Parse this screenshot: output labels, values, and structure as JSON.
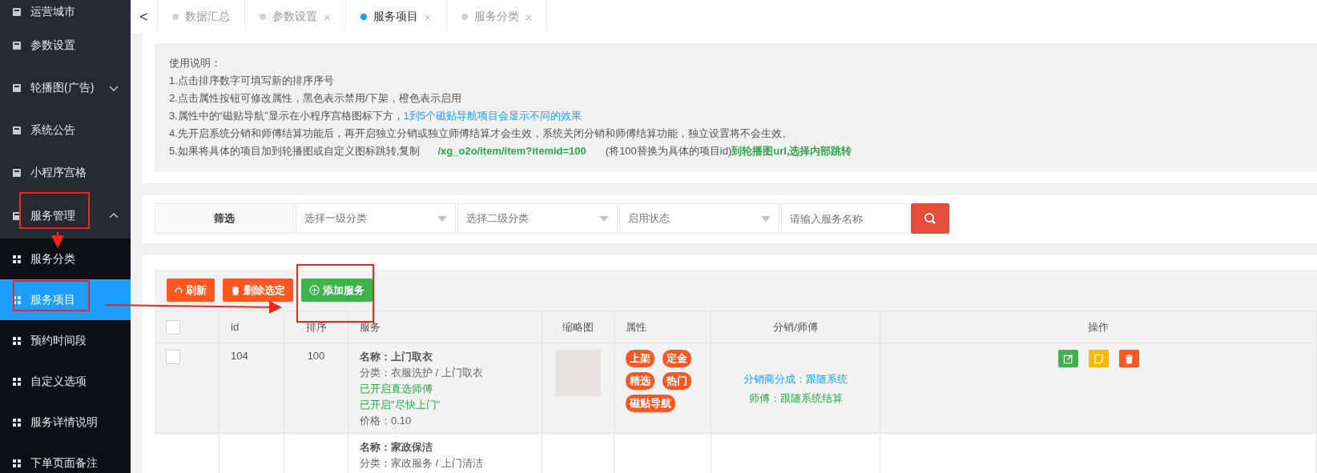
{
  "sidebar": {
    "items": [
      {
        "label": "运营城市"
      },
      {
        "label": "参数设置"
      },
      {
        "label": "轮播图(广告)",
        "expanded": false
      },
      {
        "label": "系统公告"
      },
      {
        "label": "小程序宫格"
      },
      {
        "label": "服务管理",
        "expanded": true,
        "children": [
          {
            "label": "服务分类",
            "selected": false
          },
          {
            "label": "服务项目",
            "selected": true
          },
          {
            "label": "预约时间段",
            "selected": false
          },
          {
            "label": "自定义选项",
            "selected": false
          },
          {
            "label": "服务详情说明",
            "selected": false
          },
          {
            "label": "下单页面备注",
            "selected": false
          }
        ]
      }
    ]
  },
  "tabs": [
    {
      "label": "数据汇总",
      "selected": false,
      "closable": false
    },
    {
      "label": "参数设置",
      "selected": false,
      "closable": true
    },
    {
      "label": "服务项目",
      "selected": true,
      "closable": true
    },
    {
      "label": "服务分类",
      "selected": false,
      "closable": true
    }
  ],
  "tab_close_glyph": "×",
  "back_glyph": "<",
  "instructions": [
    [
      {
        "kind": "plain",
        "text": "使用说明："
      }
    ],
    [
      {
        "kind": "plain",
        "text": "1.点击排序数字可填写新的排序序号"
      }
    ],
    [
      {
        "kind": "plain",
        "text": "2.点击属性按钮可修改属性，黑色表示禁用/下架，橙色表示启用"
      }
    ],
    [
      {
        "kind": "plain",
        "text": "3.属性中的“磁贴导航”显示在小程序宫格图标下方，"
      },
      {
        "kind": "blue",
        "text": "1到5个磁贴导航项目会显示不同的效果"
      }
    ],
    [
      {
        "kind": "plain",
        "text": "4.先开启系统分销和师傅结算功能后，再开启独立分销或独立师傅结算才会生效，系统关闭分销和师傅结算功能，独立设置将不会生效。"
      }
    ],
    [
      {
        "kind": "plain",
        "text": "5.如果将具体的项目加到轮播图或自定义图标跳转,复制"
      },
      {
        "kind": "code",
        "text": "/xg_o2o/item/item?itemid=100"
      },
      {
        "kind": "plain",
        "text": "(将100替换为具体的项目id)"
      },
      {
        "kind": "green",
        "text": "到轮播图url,选择内部跳转"
      }
    ]
  ],
  "filter": {
    "label": "筛选",
    "selects": [
      {
        "placeholder": "选择一级分类"
      },
      {
        "placeholder": "选择二级分类"
      },
      {
        "placeholder": "启用状态"
      }
    ],
    "search": {
      "placeholder": "请输入服务名称"
    }
  },
  "toolbar": [
    {
      "label": "刷新",
      "kind": "refresh"
    },
    {
      "label": "删除选定",
      "kind": "delete"
    },
    {
      "label": "添加服务",
      "kind": "add"
    }
  ],
  "table": {
    "select_all_checked": false,
    "columns": [
      "",
      "id",
      "排序",
      "服务",
      "缩略图",
      "属性",
      "分销/师傅",
      "操作"
    ],
    "rows": [
      {
        "highlighted": true,
        "checkbox": true,
        "checked": false,
        "id": "104",
        "sort": "100",
        "service": [
          {
            "kind": "name",
            "text": "名称：上门取衣"
          },
          {
            "kind": "category",
            "text": "分类：衣服洗护 / 上门取衣"
          },
          {
            "kind": "enabled",
            "text": "已开启直选师傅"
          },
          {
            "kind": "enabled",
            "text": "已开启\"尽快上门\""
          },
          {
            "kind": "price",
            "text": "价格：0.10"
          }
        ],
        "thumbnail": true,
        "tags": [
          {
            "label": "上架",
            "on": true
          },
          {
            "label": "定金",
            "on": true
          },
          {
            "label": "精选",
            "on": true
          },
          {
            "label": "热门",
            "on": true
          },
          {
            "label": "磁贴导航",
            "on": true
          }
        ],
        "distribution": [
          {
            "kind": "dealer",
            "text": "分销商分成：跟随系统"
          },
          {
            "kind": "master",
            "text": "师傅：跟随系统结算"
          }
        ],
        "actions": [
          {
            "kind": "edit"
          },
          {
            "kind": "note"
          },
          {
            "kind": "delete"
          }
        ]
      },
      {
        "highlighted": false,
        "checkbox": false,
        "service": [
          {
            "kind": "name",
            "text": "名称：家政保洁"
          },
          {
            "kind": "category",
            "text": "分类：家政服务 / 上门清洁"
          }
        ]
      }
    ]
  }
}
